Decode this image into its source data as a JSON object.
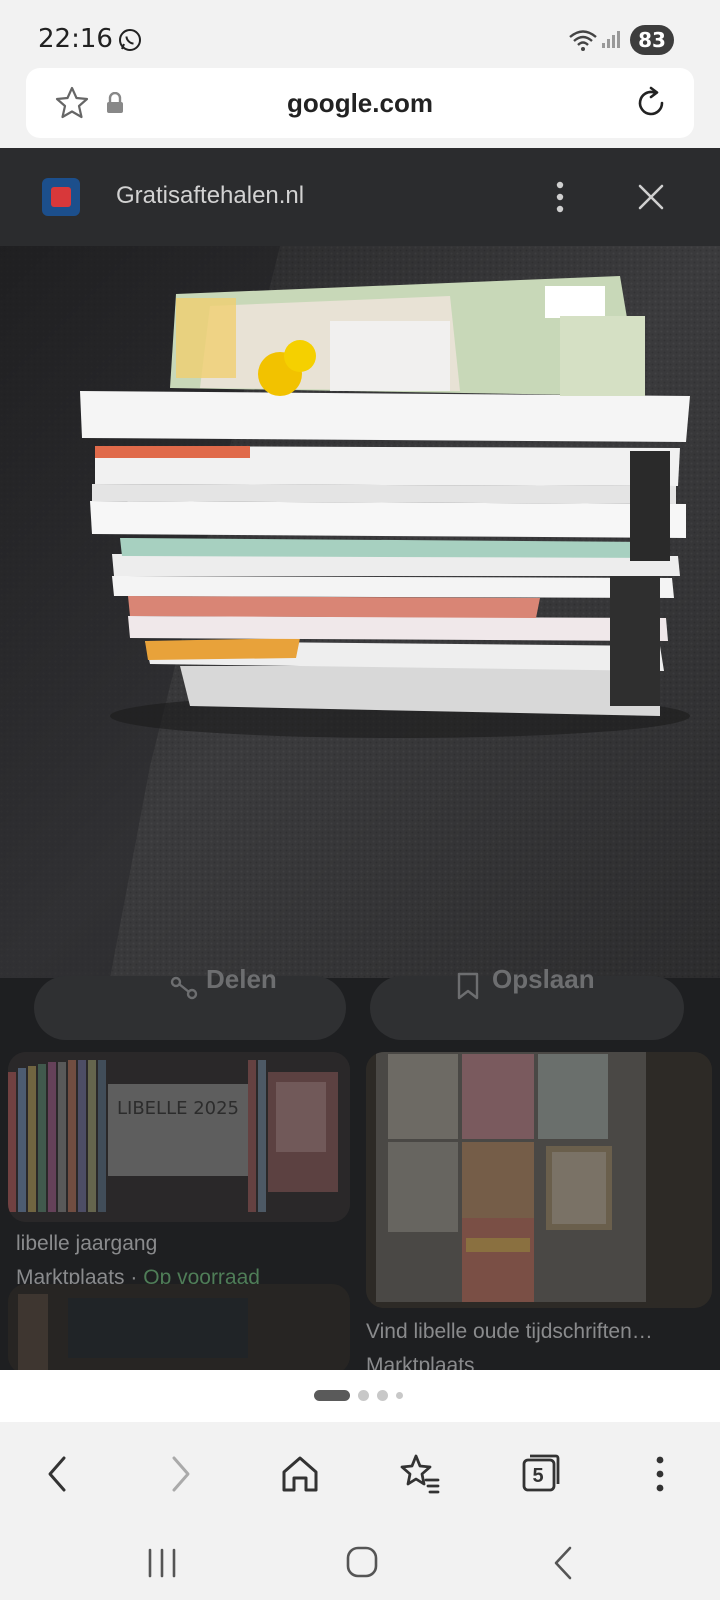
{
  "status_bar": {
    "time": "22:16",
    "battery": "83",
    "icons": [
      "whatsapp-icon",
      "wifi-icon",
      "signal-icon"
    ]
  },
  "url_bar": {
    "url": "google.com",
    "icons": [
      "star-outline-icon",
      "lock-icon",
      "reload-icon"
    ]
  },
  "image_viewer": {
    "source_name": "Gratisaftehalen.nl",
    "share_label": "Delen",
    "save_label": "Opslaan"
  },
  "results": [
    {
      "title": "libelle jaargang",
      "source": "Marktplaats",
      "separator": "·",
      "stock": "Op voorraad"
    },
    {
      "title": "Vind libelle oude tijdschriften…",
      "source": "Marktplaats"
    }
  ],
  "thumb_text": {
    "sign": "LIBELLE 2025"
  },
  "page_indicator": {
    "count": 4,
    "active": 0
  },
  "toolbar": {
    "tabs_count": "5",
    "icons": [
      "back-icon",
      "forward-icon",
      "home-icon",
      "bookmarks-icon",
      "tabs-icon",
      "menu-icon"
    ]
  },
  "nav_bar": {
    "icons": [
      "recents-icon",
      "home-circle-icon",
      "nav-back-icon"
    ]
  },
  "colors": {
    "dim_background": "#1e1f21",
    "stock_green": "#4f7d57",
    "battery_bg": "#3d3d3d"
  }
}
